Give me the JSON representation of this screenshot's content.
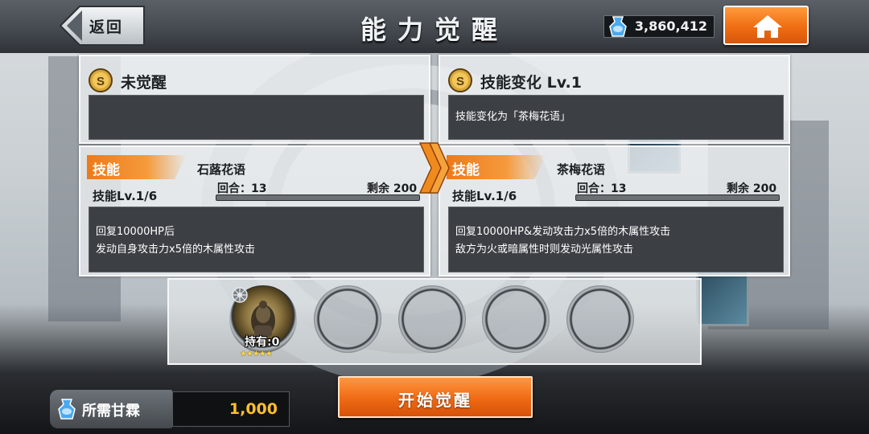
{
  "header": {
    "back_label": "返回",
    "title": "能力觉醒",
    "currency_value": "3,860,412"
  },
  "left_panel": {
    "status_title": "未觉醒",
    "status_text": "",
    "skill_tag": "技能",
    "skill_name": "石蕗花语",
    "skill_level": "技能Lv.1/6",
    "turns_label": "回合：13",
    "remaining_label": "剩余 200",
    "description_lines": [
      "回复10000HP后",
      "发动自身攻击力x5倍的木属性攻击"
    ]
  },
  "right_panel": {
    "status_title": "技能变化 Lv.1",
    "status_text": "技能变化为「茶梅花语」",
    "skill_tag": "技能",
    "skill_name": "茶梅花语",
    "skill_level": "技能Lv.1/6",
    "turns_label": "回合：13",
    "remaining_label": "剩余 200",
    "description_lines": [
      "回复10000HP&发动攻击力x5倍的木属性攻击",
      "敌方为火或暗属性时则发动光属性攻击"
    ]
  },
  "materials": {
    "owned_label": "持有:0",
    "stars": "★★★★★"
  },
  "footer": {
    "required_label": "所需甘霖",
    "required_value": "1,000",
    "start_button": "开始觉醒"
  },
  "colors": {
    "accent_orange": "#ef6d12",
    "dark_box": "#3c3f44",
    "required_value": "#ffbe2e"
  },
  "icons": [
    "back-arrow-icon",
    "gem-potion-icon",
    "home-icon",
    "skill-coin-icon",
    "double-chevron-icon",
    "buddha-statue-icon",
    "settings-gear-icon"
  ]
}
